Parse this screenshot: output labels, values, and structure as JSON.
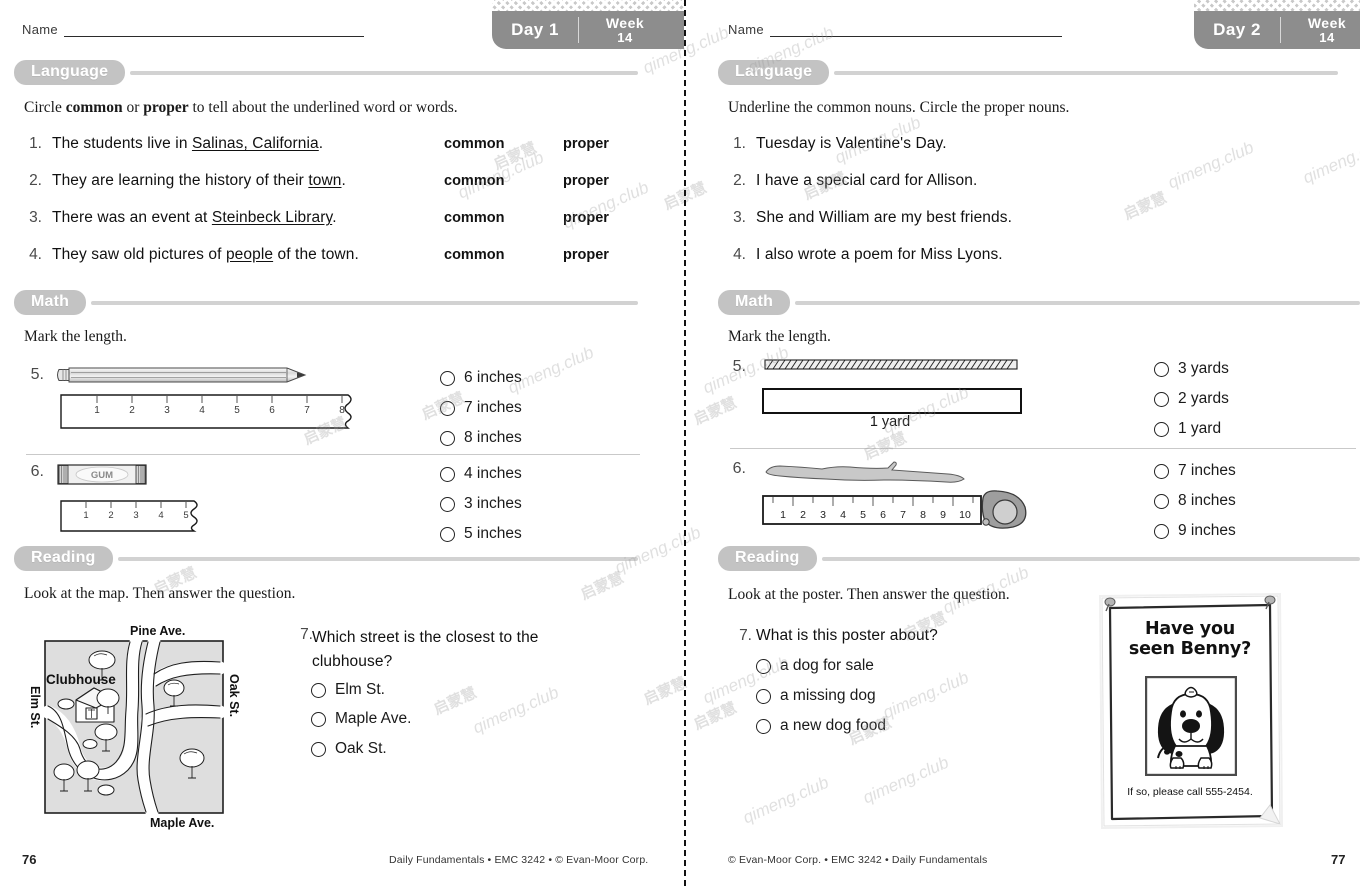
{
  "document": {
    "title": "Daily Fundamentals Week 14 Days 1-2",
    "accent_gray": "#8d8d8d",
    "pill_gray": "#c3c3c3",
    "rule_gray": "#d2d2d2"
  },
  "watermark": {
    "latin": "qimeng.club",
    "cjk": "启蒙慧"
  },
  "left_page": {
    "badge": {
      "day": "Day 1",
      "week_label": "Week",
      "week_number": "14"
    },
    "name_label": "Name",
    "sections": {
      "language": {
        "heading": "Language",
        "instruction_pre": "Circle ",
        "instruction_b1": "common",
        "instruction_mid": " or ",
        "instruction_b2": "proper",
        "instruction_post": " to tell about the underlined word or words.",
        "choice_a": "common",
        "choice_b": "proper",
        "items": [
          {
            "num": "1.",
            "pre": "The students live in ",
            "under": "Salinas, California",
            "post": "."
          },
          {
            "num": "2.",
            "pre": "They are learning the history of their ",
            "under": "town",
            "post": "."
          },
          {
            "num": "3.",
            "pre": "There was an event at ",
            "under": "Steinbeck Library",
            "post": "."
          },
          {
            "num": "4.",
            "pre": "They saw old pictures of ",
            "under": "people",
            "post": " of the town."
          }
        ]
      },
      "math": {
        "heading": "Math",
        "instruction": "Mark the length.",
        "problems": [
          {
            "num": "5.",
            "object": "pencil",
            "ruler_ticks": [
              "1",
              "2",
              "3",
              "4",
              "5",
              "6",
              "7",
              "8"
            ],
            "choices": [
              "6 inches",
              "7 inches",
              "8 inches"
            ]
          },
          {
            "num": "6.",
            "object": "gum-pack",
            "object_label": "GUM",
            "ruler_ticks": [
              "1",
              "2",
              "3",
              "4",
              "5"
            ],
            "choices": [
              "4 inches",
              "3 inches",
              "5 inches"
            ]
          }
        ]
      },
      "reading": {
        "heading": "Reading",
        "instruction": "Look at the map. Then answer the question.",
        "map": {
          "label_top": "Pine Ave.",
          "label_bottom": "Maple Ave.",
          "label_left": "Elm St.",
          "label_right": "Oak St.",
          "label_building": "Clubhouse"
        },
        "question": {
          "num": "7.",
          "text": "Which street is the closest to the clubhouse?"
        },
        "choices": [
          "Elm St.",
          "Maple Ave.",
          "Oak St."
        ]
      }
    },
    "footer": {
      "page_number": "76",
      "credit": "Daily Fundamentals • EMC 3242 • © Evan-Moor Corp."
    }
  },
  "right_page": {
    "badge": {
      "day": "Day 2",
      "week_label": "Week",
      "week_number": "14"
    },
    "name_label": "Name",
    "sections": {
      "language": {
        "heading": "Language",
        "instruction": "Underline the common nouns. Circle the proper nouns.",
        "items": [
          {
            "num": "1.",
            "text": "Tuesday is Valentine's Day."
          },
          {
            "num": "2.",
            "text": "I have a special card for Allison."
          },
          {
            "num": "3.",
            "text": "She and William are my best friends."
          },
          {
            "num": "4.",
            "text": "I also wrote a poem for Miss Lyons."
          }
        ]
      },
      "math": {
        "heading": "Math",
        "instruction": "Mark the length.",
        "problems": [
          {
            "num": "5.",
            "object": "rope",
            "bar_label": "1 yard",
            "choices": [
              "3 yards",
              "2 yards",
              "1 yard"
            ]
          },
          {
            "num": "6.",
            "object": "stick-with-tape-measure",
            "ruler_ticks": [
              "1",
              "2",
              "3",
              "4",
              "5",
              "6",
              "7",
              "8",
              "9",
              "10"
            ],
            "choices": [
              "7 inches",
              "8 inches",
              "9 inches"
            ]
          }
        ]
      },
      "reading": {
        "heading": "Reading",
        "instruction": "Look at the poster. Then answer the question.",
        "poster": {
          "headline_line1": "Have you",
          "headline_line2": "seen Benny?",
          "caption": "If so, please call 555-2454."
        },
        "question": {
          "num": "7.",
          "text": "What is this poster about?"
        },
        "choices": [
          "a dog for sale",
          "a missing dog",
          "a new dog food"
        ]
      }
    },
    "footer": {
      "page_number": "77",
      "credit": "© Evan-Moor Corp. • EMC 3242 • Daily Fundamentals"
    }
  }
}
